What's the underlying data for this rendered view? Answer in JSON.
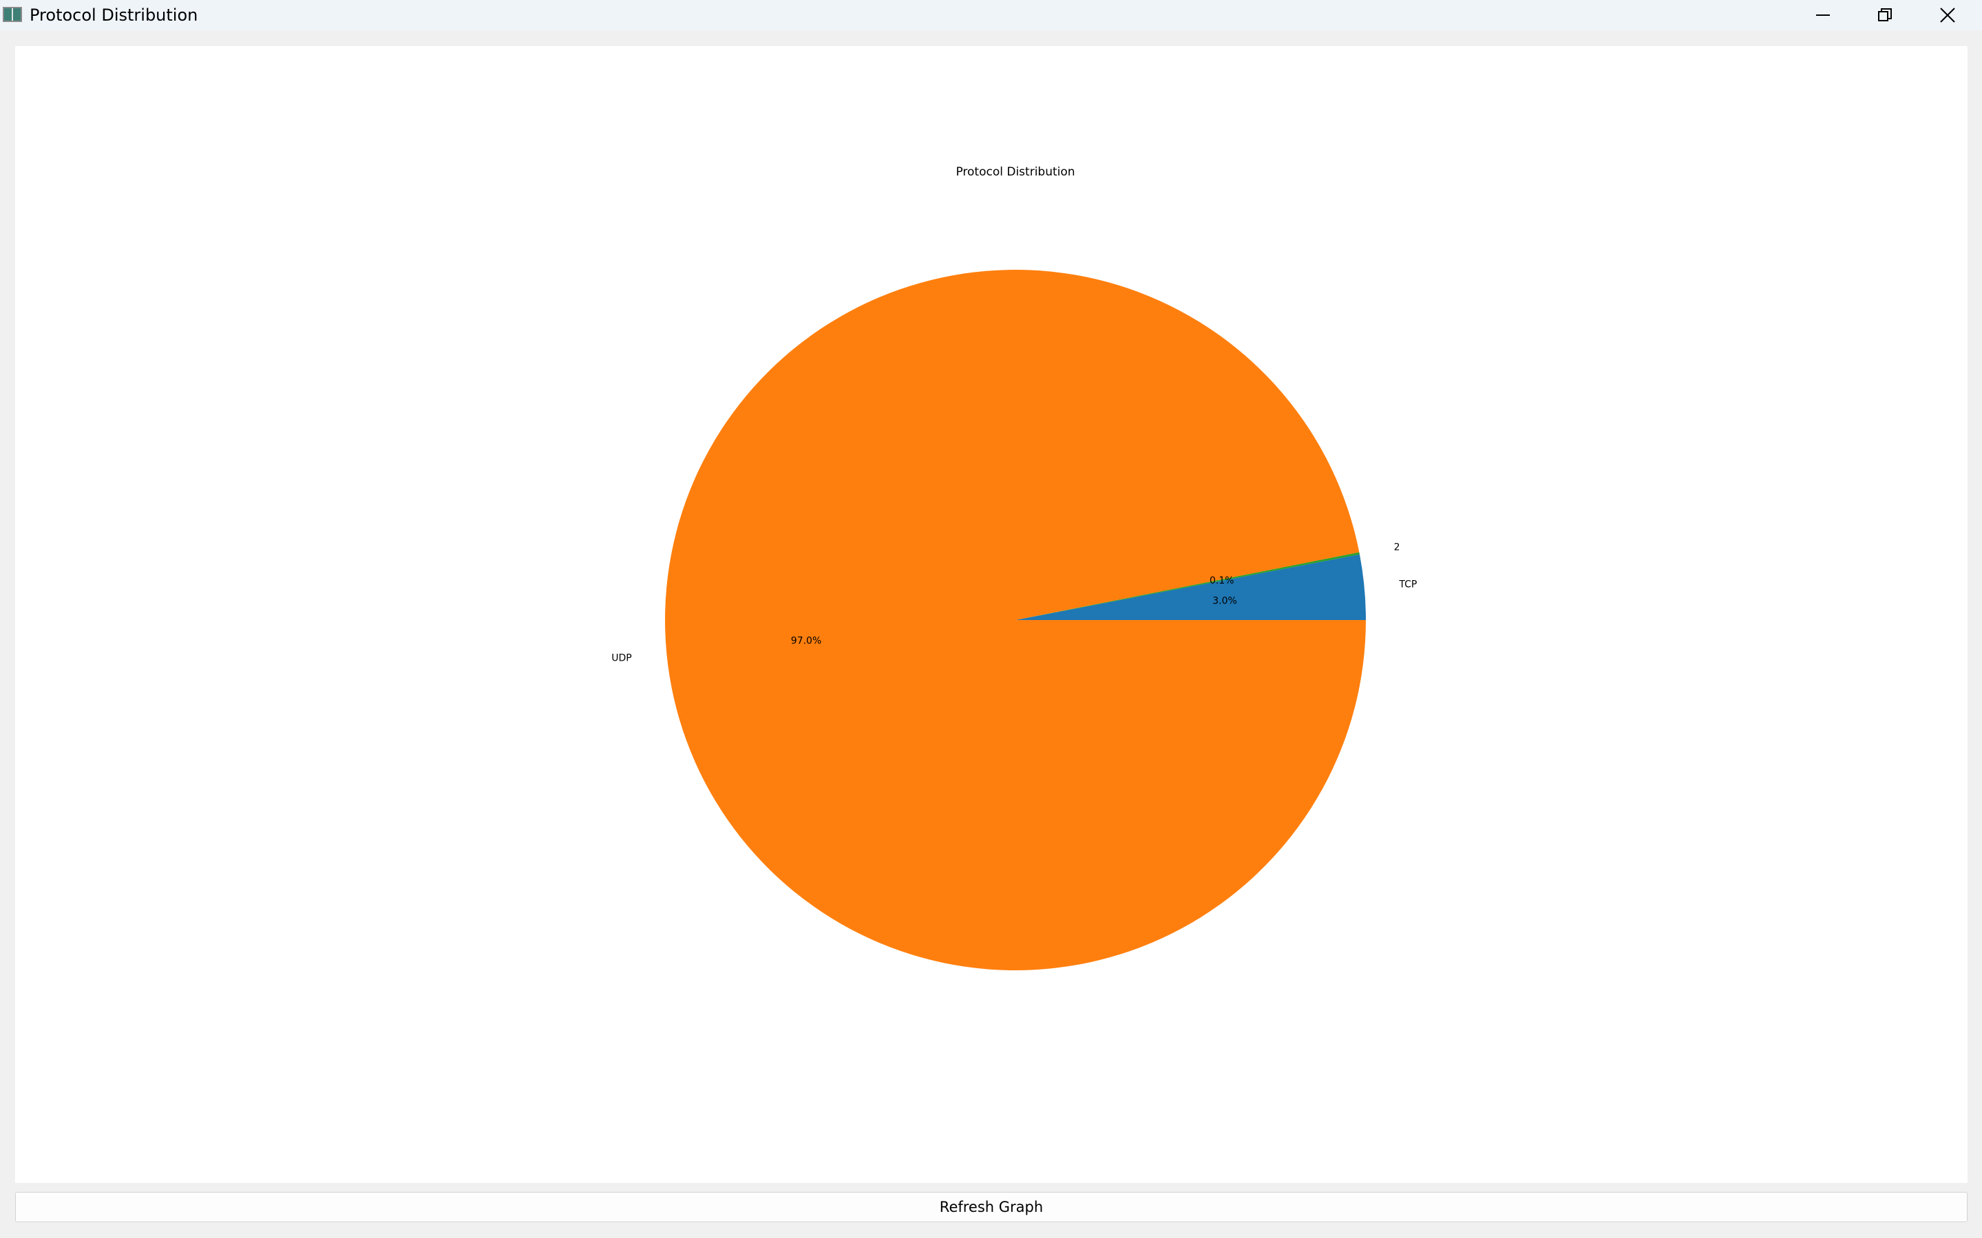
{
  "window": {
    "title": "Protocol Distribution",
    "controls": [
      "minimize-icon",
      "restore-icon",
      "close-icon"
    ]
  },
  "chart_data": {
    "type": "pie",
    "title": "Protocol Distribution",
    "slices": [
      {
        "label": "TCP",
        "value": 3.0,
        "pct_label": "3.0%",
        "color": "#1f77b4"
      },
      {
        "label": "2",
        "value": 0.1,
        "pct_label": "0.1%",
        "color": "#2ca02c"
      },
      {
        "label": "UDP",
        "value": 96.9,
        "pct_label": "97.0%",
        "color": "#ff7f0e"
      }
    ],
    "start_angle_deg": 0,
    "direction": "counterclockwise",
    "legend": "none"
  },
  "actions": {
    "refresh_label": "Refresh Graph"
  }
}
